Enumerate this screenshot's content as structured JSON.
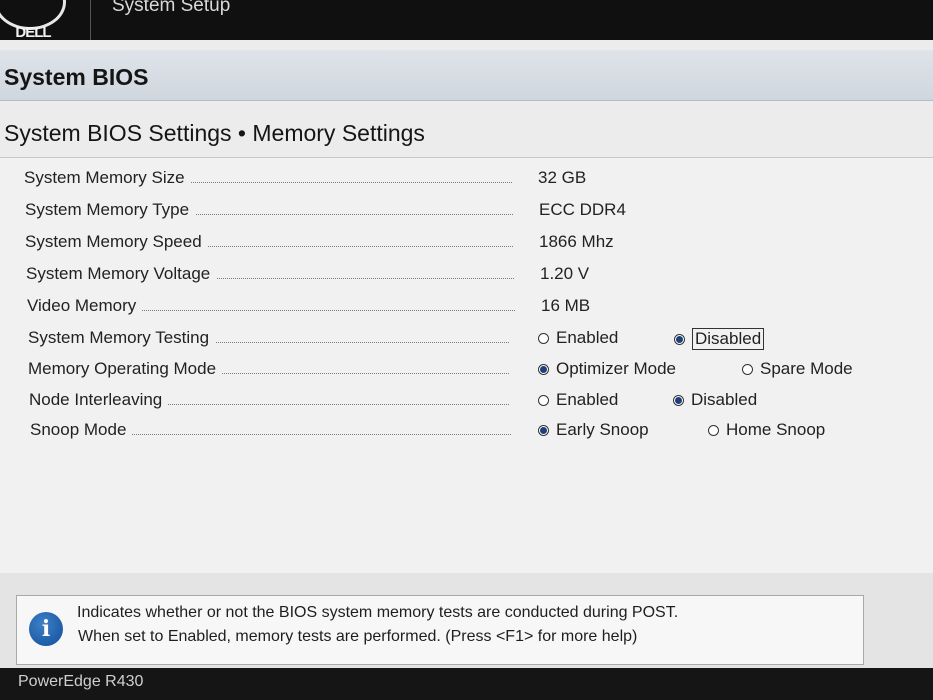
{
  "header": {
    "logo_text": "DELL",
    "app_title": "System Setup"
  },
  "section": {
    "title": "System BIOS"
  },
  "page": {
    "title": "System BIOS Settings • Memory Settings"
  },
  "settings": [
    {
      "label": "System Memory Size",
      "value": "32 GB"
    },
    {
      "label": "System Memory Type",
      "value": "ECC DDR4"
    },
    {
      "label": "System Memory Speed",
      "value": "1866 Mhz"
    },
    {
      "label": "System Memory Voltage",
      "value": "1.20 V"
    },
    {
      "label": "Video Memory",
      "value": "16 MB"
    },
    {
      "label": "System Memory Testing",
      "options": [
        "Enabled",
        "Disabled"
      ],
      "selected": "Disabled"
    },
    {
      "label": "Memory Operating Mode",
      "options": [
        "Optimizer Mode",
        "Spare Mode"
      ],
      "selected": "Optimizer Mode"
    },
    {
      "label": "Node Interleaving",
      "options": [
        "Enabled",
        "Disabled"
      ],
      "selected": "Disabled"
    },
    {
      "label": "Snoop Mode",
      "options": [
        "Early Snoop",
        "Home Snoop"
      ],
      "selected": "Early Snoop"
    }
  ],
  "help": {
    "icon": "info-icon",
    "line1": "Indicates whether or not the BIOS system memory tests are conducted during POST.",
    "line2": "When set to Enabled, memory tests are performed. (Press <F1> for more help)"
  },
  "footer": {
    "model": "PowerEdge R430"
  },
  "colors": {
    "header_bg": "#101010",
    "section_bg": "#d5dbe2",
    "content_bg": "#f1f1f1",
    "radio_selected": "#1f3f7a",
    "info_icon": "#1a5ca8"
  }
}
